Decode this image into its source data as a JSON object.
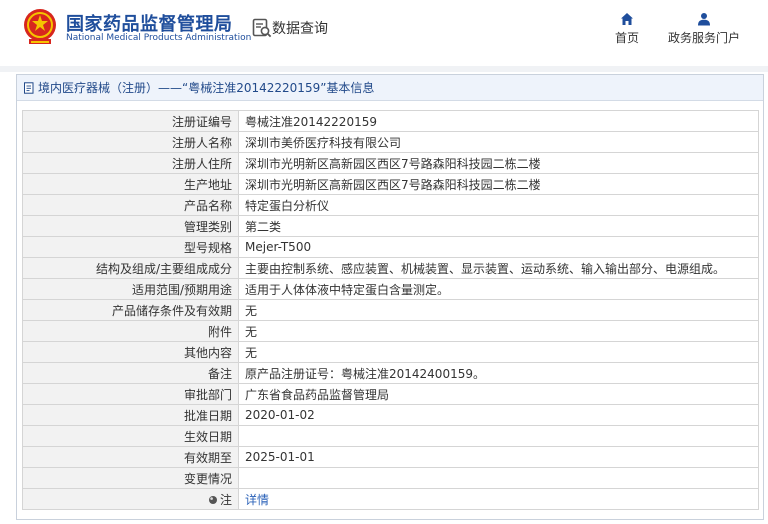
{
  "header": {
    "logo_cn": "国家药品监督管理局",
    "logo_en": "National Medical Products Administration",
    "query_label": "数据查询",
    "nav": [
      {
        "label": "首页",
        "icon": "home-icon"
      },
      {
        "label": "政务服务门户",
        "icon": "user-icon"
      }
    ]
  },
  "breadcrumb": {
    "category": "境内医疗器械（注册）",
    "separator": "——",
    "title": "“粤械注准20142220159”基本信息"
  },
  "colors": {
    "brand": "#1f4e9c",
    "link": "#2a61b8",
    "label_bg": "#f2f2f2"
  },
  "details": [
    {
      "label": "注册证编号",
      "value": "粤械注准20142220159"
    },
    {
      "label": "注册人名称",
      "value": "深圳市美侨医疗科技有限公司"
    },
    {
      "label": "注册人住所",
      "value": "深圳市光明新区高新园区西区7号路森阳科技园二栋二楼"
    },
    {
      "label": "生产地址",
      "value": "深圳市光明新区高新园区西区7号路森阳科技园二栋二楼"
    },
    {
      "label": "产品名称",
      "value": "特定蛋白分析仪"
    },
    {
      "label": "管理类别",
      "value": "第二类"
    },
    {
      "label": "型号规格",
      "value": "Mejer-T500"
    },
    {
      "label": "结构及组成/主要组成成分",
      "value": "主要由控制系统、感应装置、机械装置、显示装置、运动系统、输入输出部分、电源组成。"
    },
    {
      "label": "适用范围/预期用途",
      "value": "适用于人体体液中特定蛋白含量测定。"
    },
    {
      "label": "产品储存条件及有效期",
      "value": "无"
    },
    {
      "label": "附件",
      "value": "无"
    },
    {
      "label": "其他内容",
      "value": "无"
    },
    {
      "label": "备注",
      "value": "原产品注册证号：粤械注准20142400159。"
    },
    {
      "label": "审批部门",
      "value": "广东省食品药品监督管理局"
    },
    {
      "label": "批准日期",
      "value": "2020-01-02"
    },
    {
      "label": "生效日期",
      "value": ""
    },
    {
      "label": "有效期至",
      "value": "2025-01-01"
    },
    {
      "label": "变更情况",
      "value": ""
    }
  ],
  "note_row": {
    "label": "注",
    "link_text": "详情"
  }
}
